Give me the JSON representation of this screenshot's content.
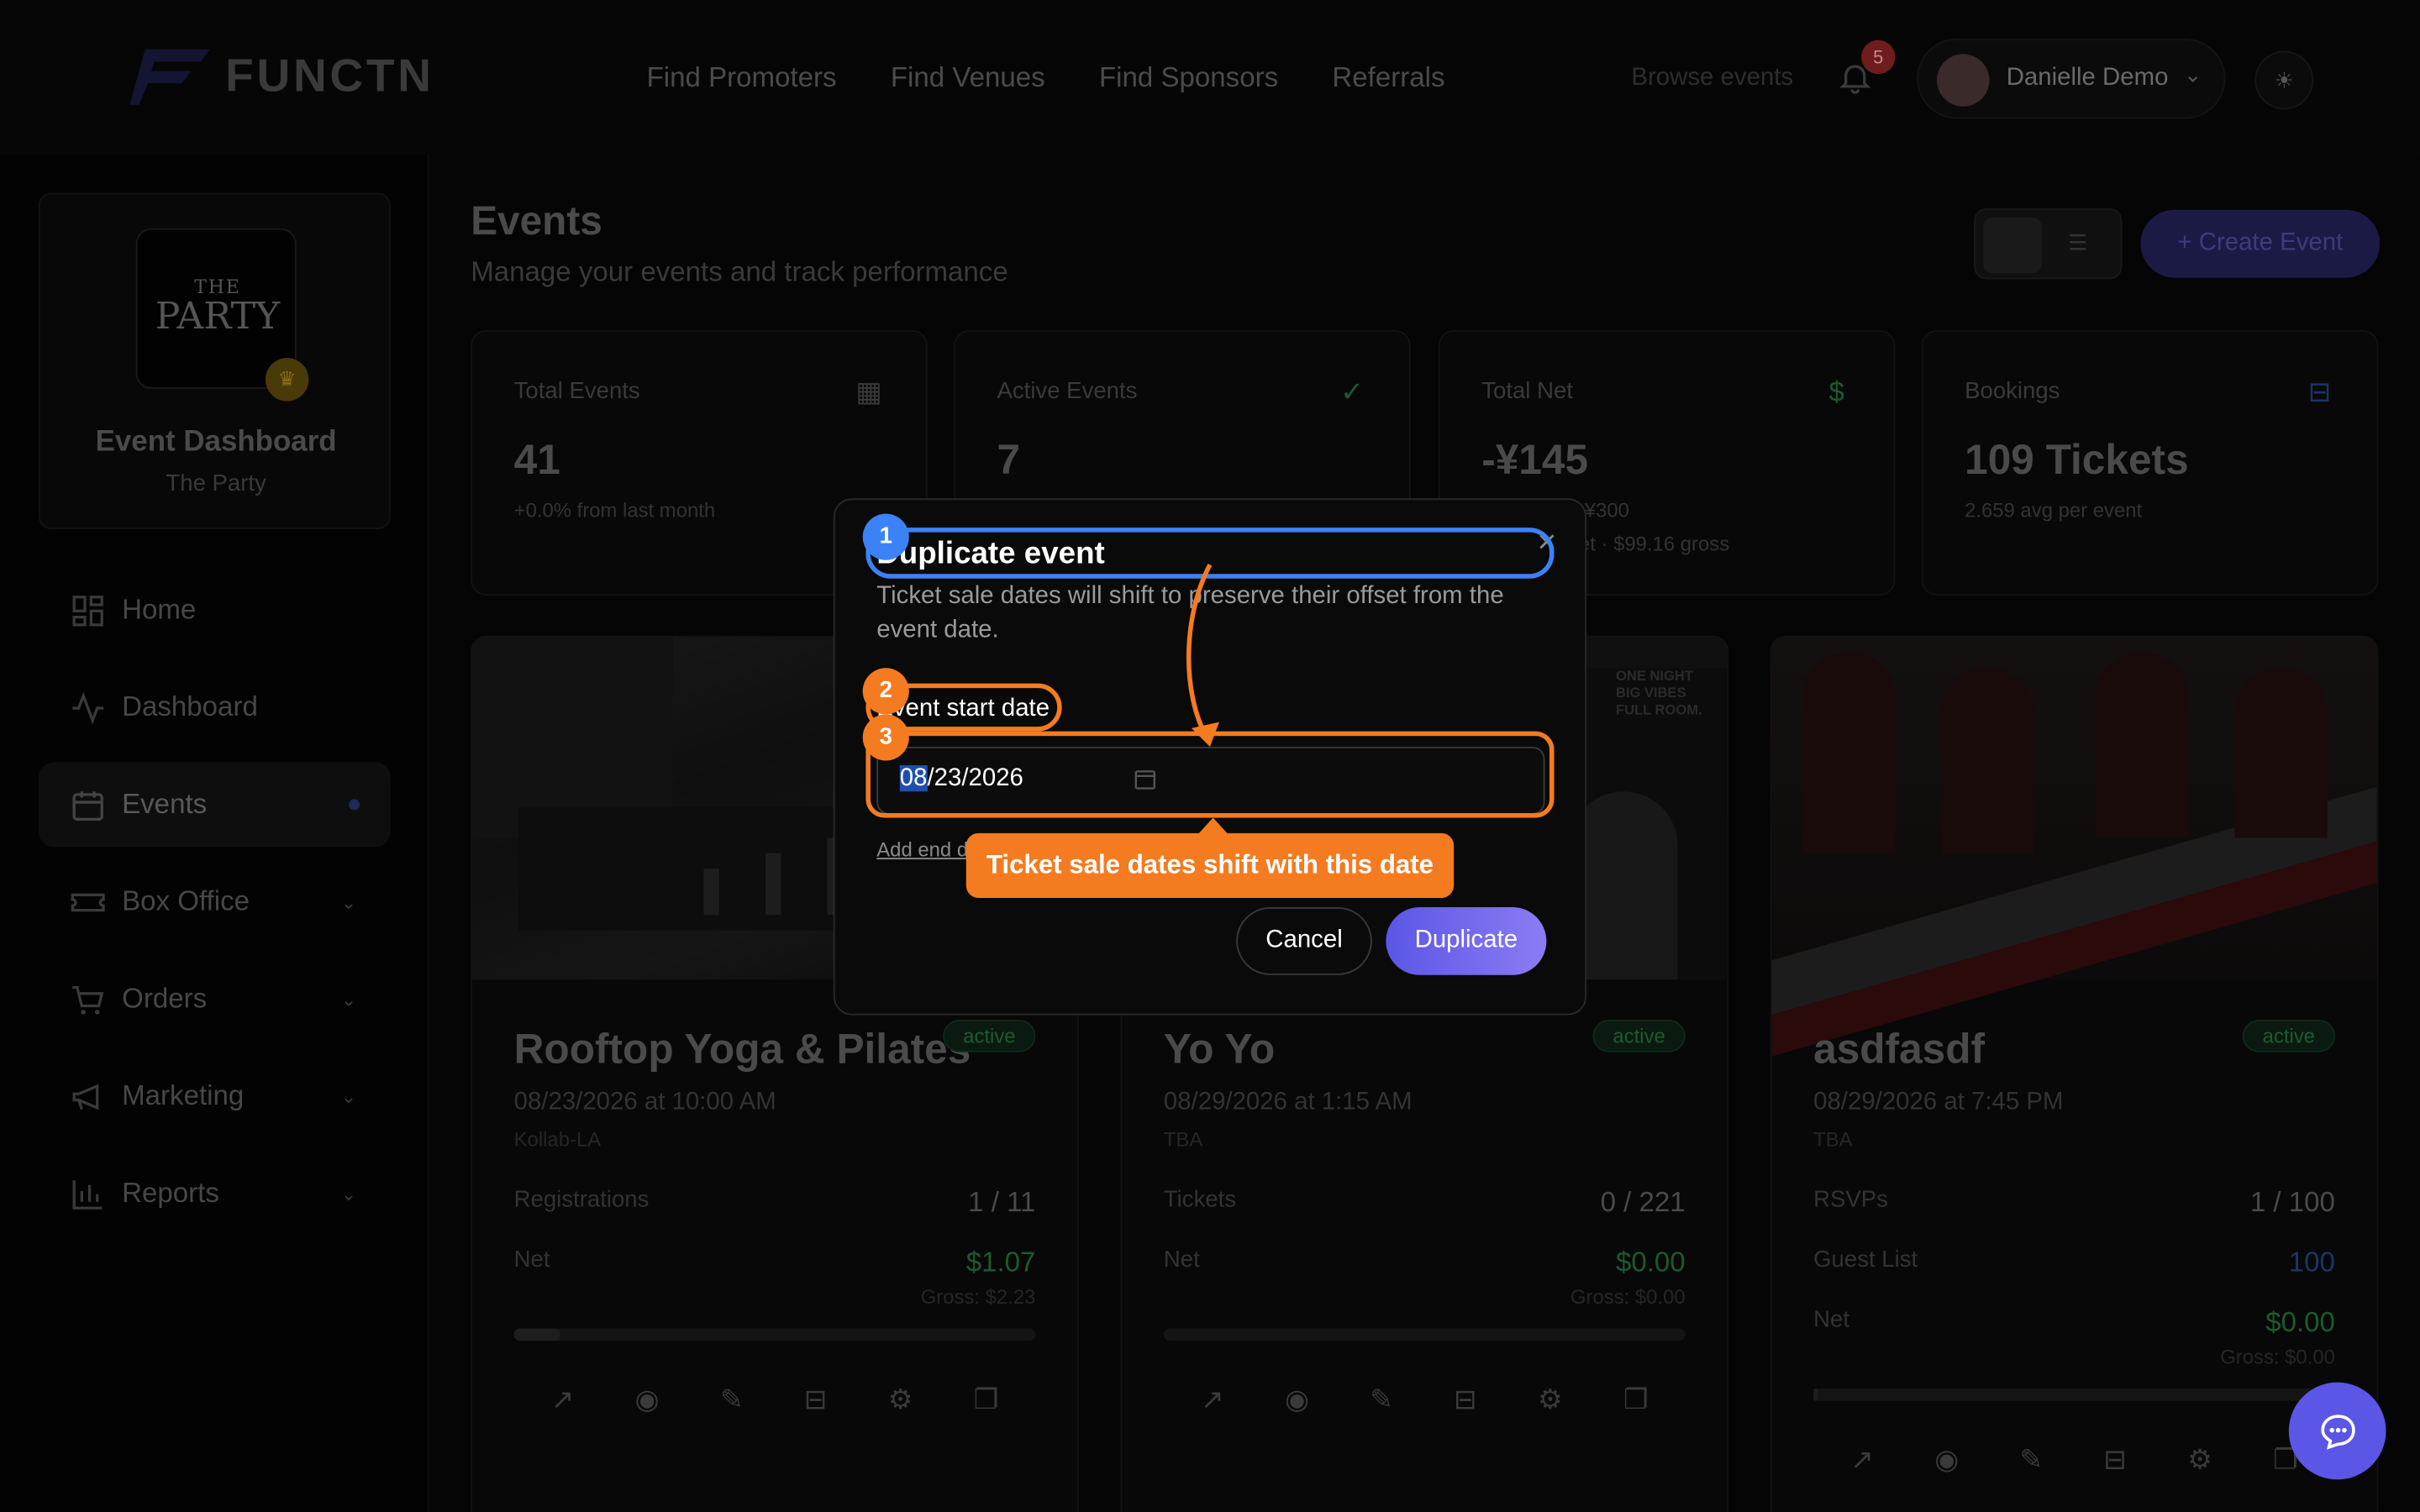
{
  "brand": {
    "name": "FUNCTN"
  },
  "nav": {
    "links": [
      "Find Promoters",
      "Find Venues",
      "Find Sponsors",
      "Referrals"
    ],
    "browse": "Browse events",
    "notifications_count": "5",
    "user_name": "Danielle Demo"
  },
  "sidebar": {
    "profile_title": "Event Dashboard",
    "profile_subtitle": "The Party",
    "logo_line1": "THE",
    "logo_line2": "PARTY",
    "items": [
      {
        "label": "Home",
        "icon": "home-icon"
      },
      {
        "label": "Dashboard",
        "icon": "activity-icon"
      },
      {
        "label": "Events",
        "icon": "calendar-icon",
        "active": true
      },
      {
        "label": "Box Office",
        "icon": "ticket-icon"
      },
      {
        "label": "Orders",
        "icon": "cart-icon"
      },
      {
        "label": "Marketing",
        "icon": "megaphone-icon"
      },
      {
        "label": "Reports",
        "icon": "bar-chart-icon"
      }
    ]
  },
  "page": {
    "title": "Events",
    "subtitle": "Manage your events and track performance",
    "create_label": "+  Create Event"
  },
  "stats": [
    {
      "label": "Total Events",
      "value": "41",
      "sub": "+0.0% from last month",
      "sub2": ""
    },
    {
      "label": "Active Events",
      "value": "7",
      "sub": "",
      "sub2": ""
    },
    {
      "label": "Total Net",
      "value": "-¥145",
      "sub": "s: ¥300",
      "sub2": "et · $99.16 gross"
    },
    {
      "label": "Bookings",
      "value": "109 Tickets",
      "sub": "2.659 avg per event",
      "sub2": ""
    }
  ],
  "cards": [
    {
      "title": "Rooftop Yoga & Pilates",
      "status": "active",
      "date": "08/23/2026 at 10:00 AM",
      "venue": "Kollab-LA",
      "row1_label": "Registrations",
      "row1_value": "1 / 11",
      "row2_label": "Net",
      "row2_value": "$1.07",
      "gross": "Gross: $2.23"
    },
    {
      "title": "Yo Yo",
      "status": "active",
      "date": "08/29/2026 at 1:15 AM",
      "venue": "TBA",
      "row1_label": "Tickets",
      "row1_value": "0 / 221",
      "row2_label": "Net",
      "row2_value": "$0.00",
      "gross": "Gross: $0.00"
    },
    {
      "title": "asdfasdf",
      "status": "active",
      "date": "08/29/2026 at 7:45 PM",
      "venue": "TBA",
      "row1_label": "RSVPs",
      "row1_value": "1 / 100",
      "row2_label": "Guest List",
      "row2_value": "100",
      "row3_label": "Net",
      "row3_value": "$0.00",
      "gross": "Gross: $0.00"
    }
  ],
  "modal": {
    "title": "Duplicate event",
    "description": "Ticket sale dates will shift to preserve their offset from the event date.",
    "field_label": "Event start date",
    "date_month": "08",
    "date_rest": "/23/2026",
    "add_end": "Add end date",
    "cancel": "Cancel",
    "duplicate": "Duplicate"
  },
  "annotations": {
    "step1": "1",
    "step2": "2",
    "step3": "3",
    "tooltip": "Ticket sale dates shift with this date"
  },
  "colors": {
    "accent": "#5b56e6",
    "annotation_blue": "#3b82f6",
    "annotation_orange": "#f47b20",
    "success": "#22c55e"
  }
}
